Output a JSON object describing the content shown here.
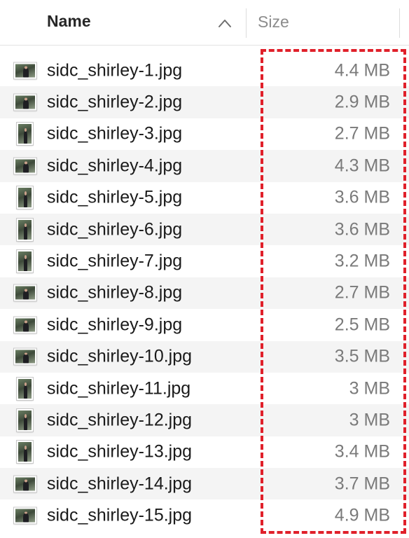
{
  "header": {
    "name_label": "Name",
    "size_label": "Size",
    "sort_icon": "chevron-up-icon"
  },
  "files": [
    {
      "name": "sidc_shirley-1.jpg",
      "size": "4.4 MB",
      "orientation": "landscape"
    },
    {
      "name": "sidc_shirley-2.jpg",
      "size": "2.9 MB",
      "orientation": "landscape"
    },
    {
      "name": "sidc_shirley-3.jpg",
      "size": "2.7 MB",
      "orientation": "portrait"
    },
    {
      "name": "sidc_shirley-4.jpg",
      "size": "4.3 MB",
      "orientation": "landscape"
    },
    {
      "name": "sidc_shirley-5.jpg",
      "size": "3.6 MB",
      "orientation": "portrait"
    },
    {
      "name": "sidc_shirley-6.jpg",
      "size": "3.6 MB",
      "orientation": "portrait"
    },
    {
      "name": "sidc_shirley-7.jpg",
      "size": "3.2 MB",
      "orientation": "portrait"
    },
    {
      "name": "sidc_shirley-8.jpg",
      "size": "2.7 MB",
      "orientation": "landscape"
    },
    {
      "name": "sidc_shirley-9.jpg",
      "size": "2.5 MB",
      "orientation": "landscape"
    },
    {
      "name": "sidc_shirley-10.jpg",
      "size": "3.5 MB",
      "orientation": "landscape"
    },
    {
      "name": "sidc_shirley-11.jpg",
      "size": "3 MB",
      "orientation": "portrait"
    },
    {
      "name": "sidc_shirley-12.jpg",
      "size": "3 MB",
      "orientation": "portrait"
    },
    {
      "name": "sidc_shirley-13.jpg",
      "size": "3.4 MB",
      "orientation": "portrait"
    },
    {
      "name": "sidc_shirley-14.jpg",
      "size": "3.7 MB",
      "orientation": "landscape"
    },
    {
      "name": "sidc_shirley-15.jpg",
      "size": "4.9 MB",
      "orientation": "landscape"
    }
  ],
  "colors": {
    "highlight": "#e0202a",
    "alt_row": "#f4f4f4",
    "size_text": "#7a7a7a"
  }
}
